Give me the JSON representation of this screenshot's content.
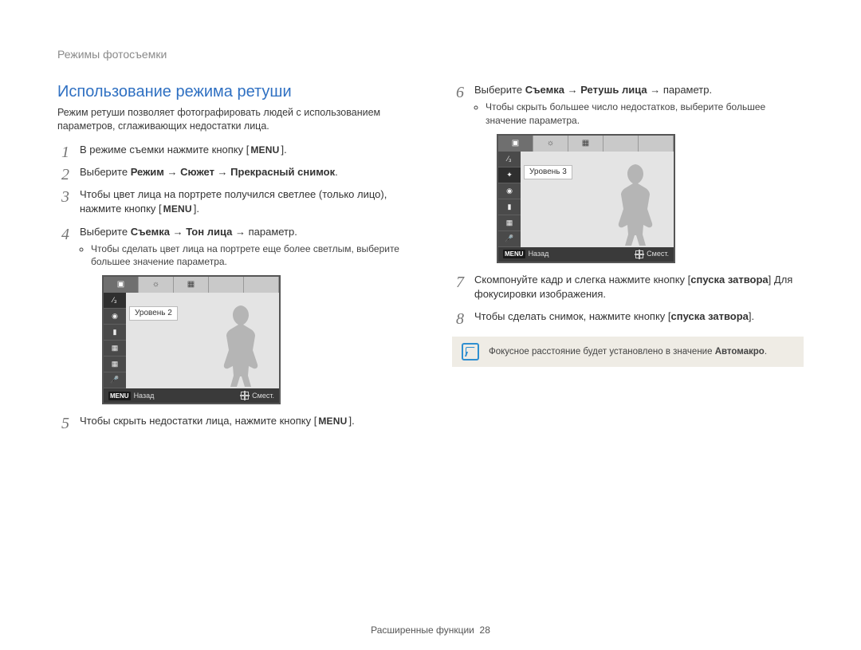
{
  "breadcrumb": "Режимы фотосъемки",
  "section_title": "Использование режима ретуши",
  "intro": "Режим ретуши позволяет фотографировать людей с использованием параметров, сглаживающих недостатки лица.",
  "menu_label": "MENU",
  "left": {
    "step1_before": "В режиме съемки нажмите кнопку [",
    "step1_after": "].",
    "step2_before": "Выберите ",
    "step2_bold": "Режим → Сюжет → Прекрасный снимок",
    "step2_after": ".",
    "step3_before": "Чтобы цвет лица на портрете получился светлее (только лицо), нажмите кнопку [",
    "step3_after": "].",
    "step4_before": "Выберите ",
    "step4_bold": "Съемка → Тон лица",
    "step4_after": " → параметр.",
    "step4_bullet": "Чтобы сделать цвет лица на портрете еще более светлым, выберите большее значение параметра.",
    "step5_before": "Чтобы скрыть недостатки лица, нажмите кнопку [",
    "step5_after": "]."
  },
  "right": {
    "step6_before": "Выберите ",
    "step6_bold": "Съемка → Ретушь лица",
    "step6_after": " → параметр.",
    "step6_bullet": "Чтобы скрыть большее число недостатков, выберите большее значение параметра.",
    "step7_a": "Скомпонуйте кадр и слегка нажмите кнопку [",
    "step7_bold1": "спуска затвора",
    "step7_b": "] Для фокусировки изображения.",
    "step8_a": "Чтобы сделать снимок, нажмите кнопку [",
    "step8_bold": "спуска затвора",
    "step8_b": "]."
  },
  "lcd_left": {
    "level": "Уровень 2",
    "back": "Назад",
    "move": "Смест."
  },
  "lcd_right": {
    "level": "Уровень 3",
    "back": "Назад",
    "move": "Смест."
  },
  "note_before": "Фокусное расстояние будет установлено в значение ",
  "note_bold": "Автомакро",
  "note_after": ".",
  "footer_label": "Расширенные функции",
  "footer_page": "28"
}
